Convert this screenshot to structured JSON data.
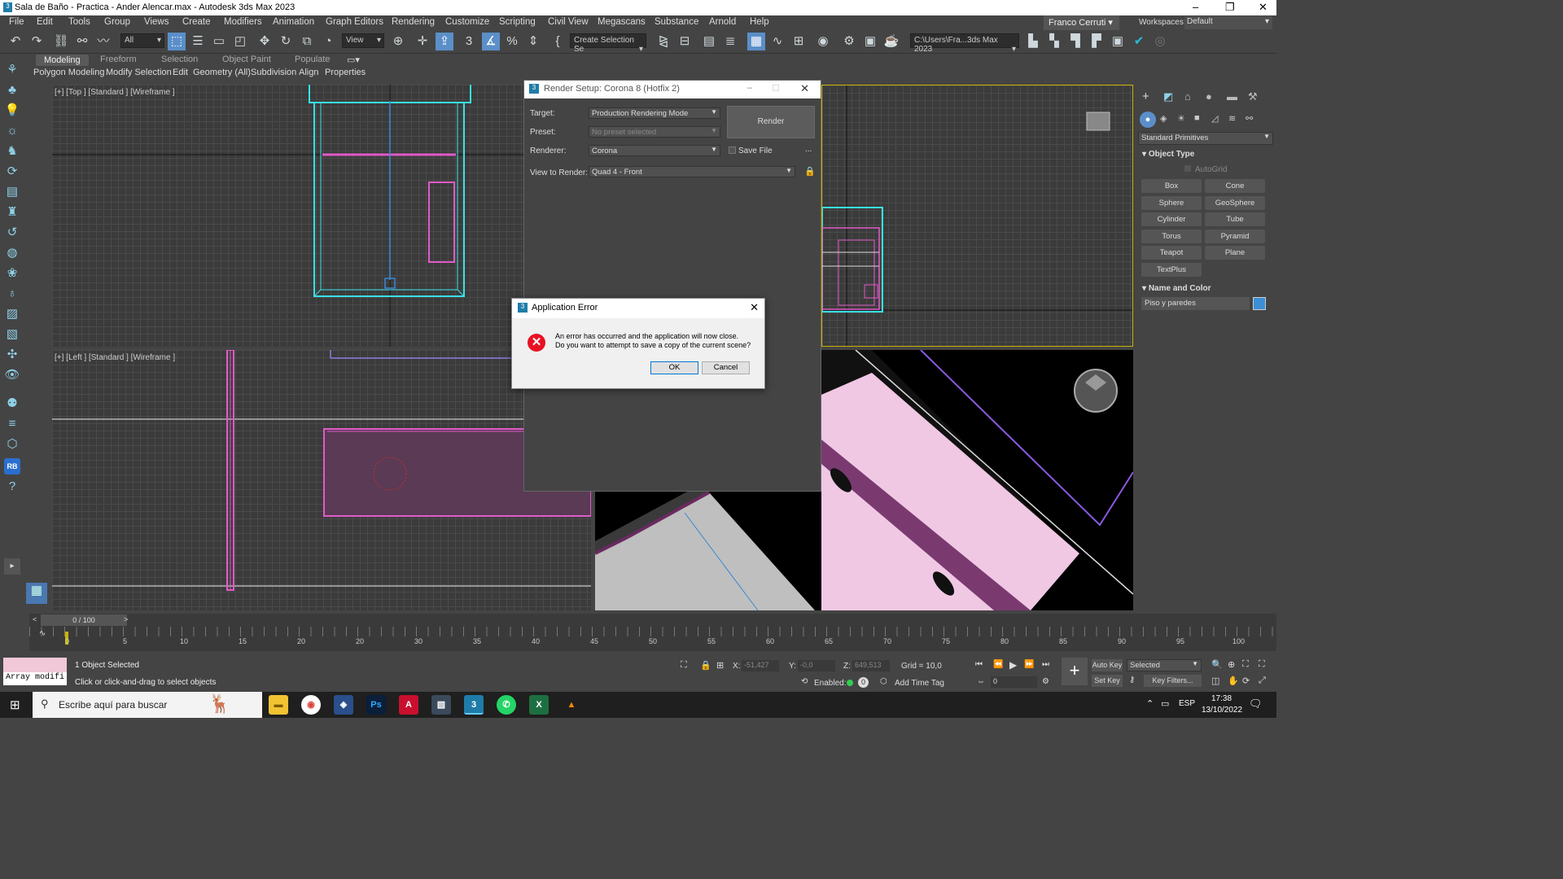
{
  "window": {
    "title": "Sala de Baño - Practica - Ander Alencar.max - Autodesk 3ds Max 2023"
  },
  "menu": [
    "File",
    "Edit",
    "Tools",
    "Group",
    "Views",
    "Create",
    "Modifiers",
    "Animation",
    "Graph Editors",
    "Rendering",
    "Customize",
    "Scripting",
    "Civil View",
    "Megascans",
    "Substance",
    "Arnold",
    "Help"
  ],
  "user": "Franco Cerruti",
  "workspace": {
    "label": "Workspaces:",
    "value": "Default"
  },
  "toolbar": {
    "selection_filter": "All",
    "ref_coord": "View",
    "named_selection": "Create Selection Se",
    "project_path": "C:\\Users\\Fra...3ds Max 2023"
  },
  "ribbon": {
    "tabs": [
      "Modeling",
      "Freeform",
      "Selection",
      "Object Paint",
      "Populate"
    ],
    "subtabs": [
      "Polygon Modeling",
      "Modify Selection",
      "Edit",
      "Geometry (All)",
      "Subdivision",
      "Align",
      "Properties"
    ]
  },
  "viewports": {
    "top": "[+] [Top ] [Standard ] [Wireframe ]",
    "left": "[+] [Left ] [Standard ] [Wireframe ]"
  },
  "render_setup": {
    "title": "Render Setup: Corona 8 (Hotfix 2)",
    "target_label": "Target:",
    "target": "Production Rendering Mode",
    "preset_label": "Preset:",
    "preset": "No preset selected",
    "renderer_label": "Renderer:",
    "renderer": "Corona",
    "save_file": "Save File",
    "more": "...",
    "view_label": "View to Render:",
    "view": "Quad 4 - Front",
    "render_button": "Render"
  },
  "error_dialog": {
    "title": "Application Error",
    "line1": "An error has occurred and the application will now close.",
    "line2": "Do you want to attempt to save a copy of the current scene?",
    "ok": "OK",
    "cancel": "Cancel"
  },
  "command_panel": {
    "category": "Standard Primitives",
    "object_type": "Object Type",
    "autogrid": "AutoGrid",
    "buttons": [
      "Box",
      "Cone",
      "Sphere",
      "GeoSphere",
      "Cylinder",
      "Tube",
      "Torus",
      "Pyramid",
      "Teapot",
      "Plane",
      "TextPlus"
    ],
    "name_and_color": "Name and Color",
    "object_name": "Piso y paredes",
    "object_color": "#3a8fd6"
  },
  "timeline": {
    "frame": "0 / 100",
    "ticks": [
      "0",
      "5",
      "10",
      "15",
      "20",
      "25",
      "30",
      "35",
      "40",
      "45",
      "50",
      "55",
      "60",
      "65",
      "70",
      "75",
      "80",
      "85",
      "90",
      "95",
      "100"
    ]
  },
  "status": {
    "script_label": "Array modifi",
    "selected": "1 Object Selected",
    "prompt": "Click or click-and-drag to select objects",
    "x_label": "X:",
    "x": "-51,427",
    "y_label": "Y:",
    "y": "-0,0",
    "z_label": "Z:",
    "z": "649,513",
    "grid": "Grid = 10,0",
    "enabled": "Enabled:",
    "add_time_tag": "Add Time Tag",
    "auto_key": "Auto Key",
    "set_key": "Set Key",
    "key_mode": "Selected",
    "key_filters": "Key Filters...",
    "frame_field": "0"
  },
  "taskbar": {
    "search_placeholder": "Escribe aquí para buscar",
    "lang": "ESP",
    "time": "17:38",
    "date": "13/10/2022"
  }
}
